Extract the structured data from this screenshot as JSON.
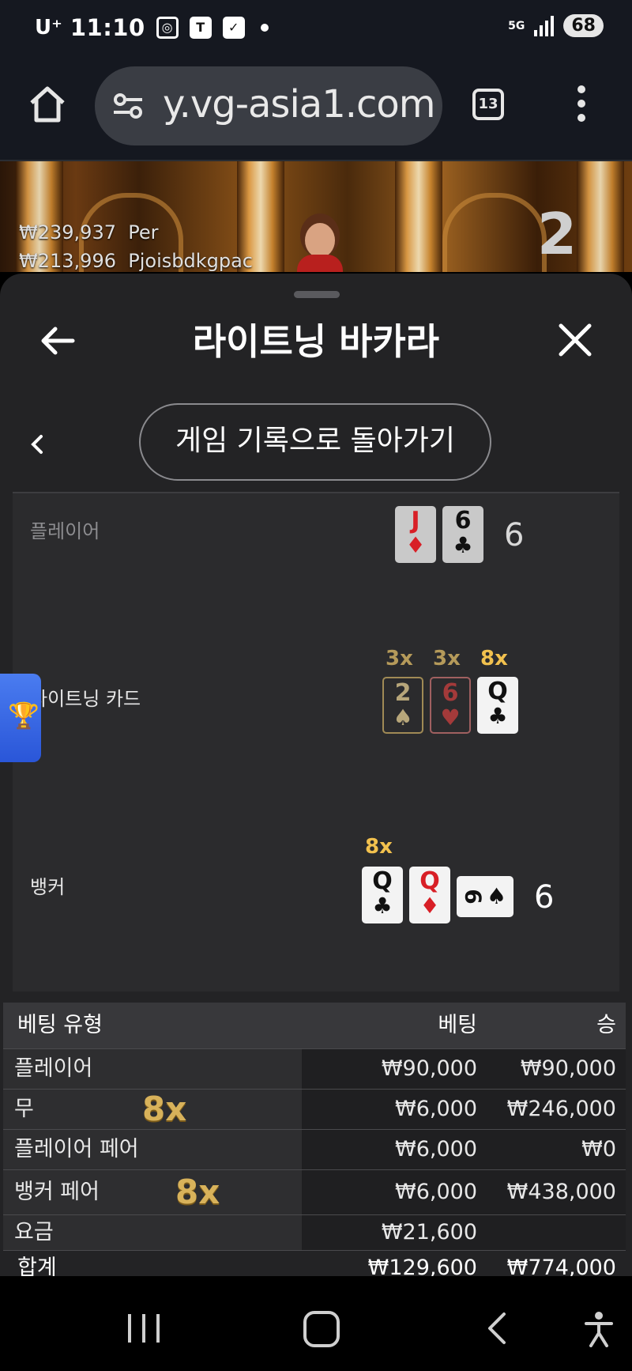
{
  "status_bar": {
    "carrier": "U⁺",
    "time": "11:10",
    "network": "5G",
    "battery": "68",
    "icons": [
      "screenshot-icon",
      "t-app-icon",
      "vpn-icon",
      "notification-dot-icon",
      "signal-icon"
    ]
  },
  "browser": {
    "url": "y.vg-asia1.com",
    "tab_count": "13",
    "icons": [
      "home-icon",
      "site-settings-icon",
      "tabs-icon",
      "more-icon"
    ]
  },
  "video": {
    "bets": [
      {
        "amount": "₩239,937",
        "player": "Per"
      },
      {
        "amount": "₩213,996",
        "player": "Pjoisbdkgpac"
      }
    ],
    "round_number": "2"
  },
  "panel": {
    "title": "라이트닝 바카라",
    "back_to_history": "게임 기록으로 돌아가기",
    "icons": [
      "back-arrow-icon",
      "close-icon",
      "chevron-left-icon",
      "trophy-icon"
    ]
  },
  "hands": {
    "player": {
      "label": "플레이어",
      "cards": [
        {
          "rank": "J",
          "suit": "♦",
          "color": "red"
        },
        {
          "rank": "6",
          "suit": "♣",
          "color": "black"
        }
      ],
      "score": "6"
    },
    "lightning": {
      "label": "라이트닝 카드",
      "cards": [
        {
          "rank": "2",
          "suit": "♠",
          "multiplier": "3x"
        },
        {
          "rank": "6",
          "suit": "♥",
          "multiplier": "3x"
        },
        {
          "rank": "Q",
          "suit": "♣",
          "multiplier": "8x"
        }
      ]
    },
    "banker": {
      "label": "뱅커",
      "multiplier": "8x",
      "cards": [
        {
          "rank": "Q",
          "suit": "♣",
          "color": "black"
        },
        {
          "rank": "Q",
          "suit": "♦",
          "color": "red"
        },
        {
          "rank": "6",
          "suit": "♠",
          "color": "black",
          "orientation": "horizontal"
        }
      ],
      "score": "6"
    }
  },
  "bet_table": {
    "headers": {
      "type": "베팅 유형",
      "bet": "베팅",
      "win": "승"
    },
    "rows": [
      {
        "type": "플레이어",
        "multiplier": "",
        "bet": "₩90,000",
        "win": "₩90,000"
      },
      {
        "type": "무",
        "multiplier": "8x",
        "bet": "₩6,000",
        "win": "₩246,000"
      },
      {
        "type": "플레이어 페어",
        "multiplier": "",
        "bet": "₩6,000",
        "win": "₩0"
      },
      {
        "type": "뱅커 페어",
        "multiplier": "8x",
        "bet": "₩6,000",
        "win": "₩438,000"
      },
      {
        "type": "요금",
        "multiplier": "",
        "bet": "₩21,600",
        "win": ""
      },
      {
        "type": "합계",
        "multiplier": "",
        "bet": "₩129,600",
        "win": "₩774,000"
      }
    ]
  },
  "colors": {
    "panel_bg": "#232325",
    "gold_multiplier": "#f2c14e",
    "card_red": "#d81f26",
    "trophy_tab": "#3a68e4"
  },
  "nav_bar": {
    "icons": [
      "recents-icon",
      "home-icon",
      "back-icon",
      "accessibility-icon"
    ]
  }
}
